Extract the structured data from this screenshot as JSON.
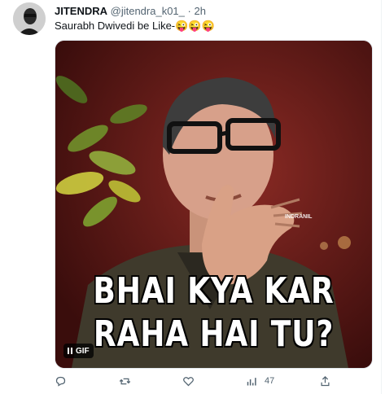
{
  "tweet": {
    "author_name": "JITENDRA",
    "author_handle": "@jitendra_k01_",
    "separator": "·",
    "time": "2h",
    "text": "Saurabh Dwivedi be Like-😜😜😜"
  },
  "media": {
    "caption_line1": "BHAI KYA KAR",
    "caption_line2": "RAHA HAI TU?",
    "watermark": "INDRANIL",
    "badge_label": "GIF"
  },
  "actions": {
    "views_count": "47"
  },
  "icons": [
    "reply-icon",
    "retweet-icon",
    "like-icon",
    "views-icon",
    "share-icon",
    "pause-icon"
  ],
  "colors": {
    "muted": "#536471",
    "text": "#0f1419"
  }
}
